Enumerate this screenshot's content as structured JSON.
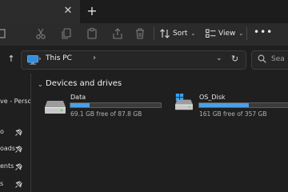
{
  "window": {
    "tab_close_glyph": "✕",
    "new_tab_glyph": "+"
  },
  "command_bar": {
    "sort_label": "Sort",
    "view_label": "View",
    "more_glyph": "•••"
  },
  "address_bar": {
    "path_label": "This PC",
    "search_placeholder": "Sea"
  },
  "nav_pane": {
    "items": [
      {
        "label": "ve - Perso"
      },
      {
        "label": "o",
        "pinned": true
      },
      {
        "label": "oads",
        "pinned": true
      },
      {
        "label": "ents",
        "pinned": true
      },
      {
        "label": "s",
        "pinned": true
      }
    ]
  },
  "content": {
    "section_title": "Devices and drives",
    "drives": [
      {
        "name": "Data",
        "free_text": "69.1 GB free of 87.8 GB",
        "used_fraction": 0.213,
        "icon": "hard-drive-icon"
      },
      {
        "name": "OS_Disk",
        "free_text": "161 GB free of 357 GB",
        "used_fraction": 0.549,
        "icon": "windows-drive-icon"
      }
    ]
  },
  "colors": {
    "accent": "#4aa0e6",
    "background": "#1f1f1f",
    "command_bar": "#2b2b2b"
  }
}
